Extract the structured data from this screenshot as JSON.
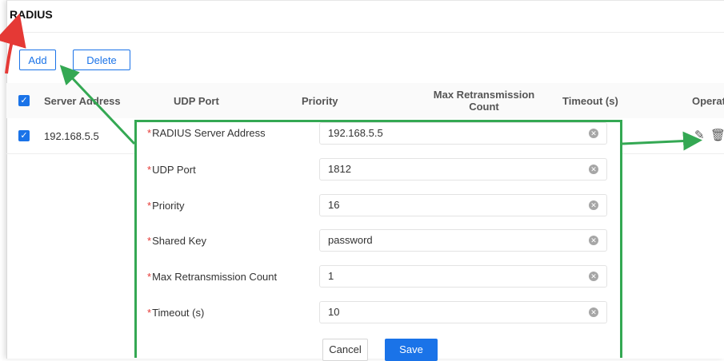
{
  "page": {
    "title": "RADIUS"
  },
  "toolbar": {
    "add_label": "Add",
    "delete_label": "Delete"
  },
  "table": {
    "headers": {
      "server_address": "Server Address",
      "udp_port": "UDP Port",
      "priority": "Priority",
      "max_retrans_line1": "Max Retransmission",
      "max_retrans_line2": "Count",
      "timeout": "Timeout (s)",
      "operation": "Operat"
    },
    "rows": [
      {
        "server_address": "192.168.5.5"
      }
    ]
  },
  "dialog": {
    "fields": [
      {
        "label": "RADIUS Server Address",
        "value": "192.168.5.5"
      },
      {
        "label": "UDP Port",
        "value": "1812"
      },
      {
        "label": "Priority",
        "value": "16"
      },
      {
        "label": "Shared Key",
        "value": "password"
      },
      {
        "label": "Max Retransmission Count",
        "value": "1"
      },
      {
        "label": "Timeout (s)",
        "value": "10"
      }
    ],
    "required_mark": "*",
    "cancel_label": "Cancel",
    "save_label": "Save"
  },
  "icons": {
    "checkbox": "checkmark",
    "edit": "edit-icon",
    "delete": "trash-icon",
    "clear": "clear-icon"
  },
  "colors": {
    "accent": "#1a73e8",
    "highlight": "#34a853",
    "arrow": "#e53935",
    "required": "#e53935"
  }
}
